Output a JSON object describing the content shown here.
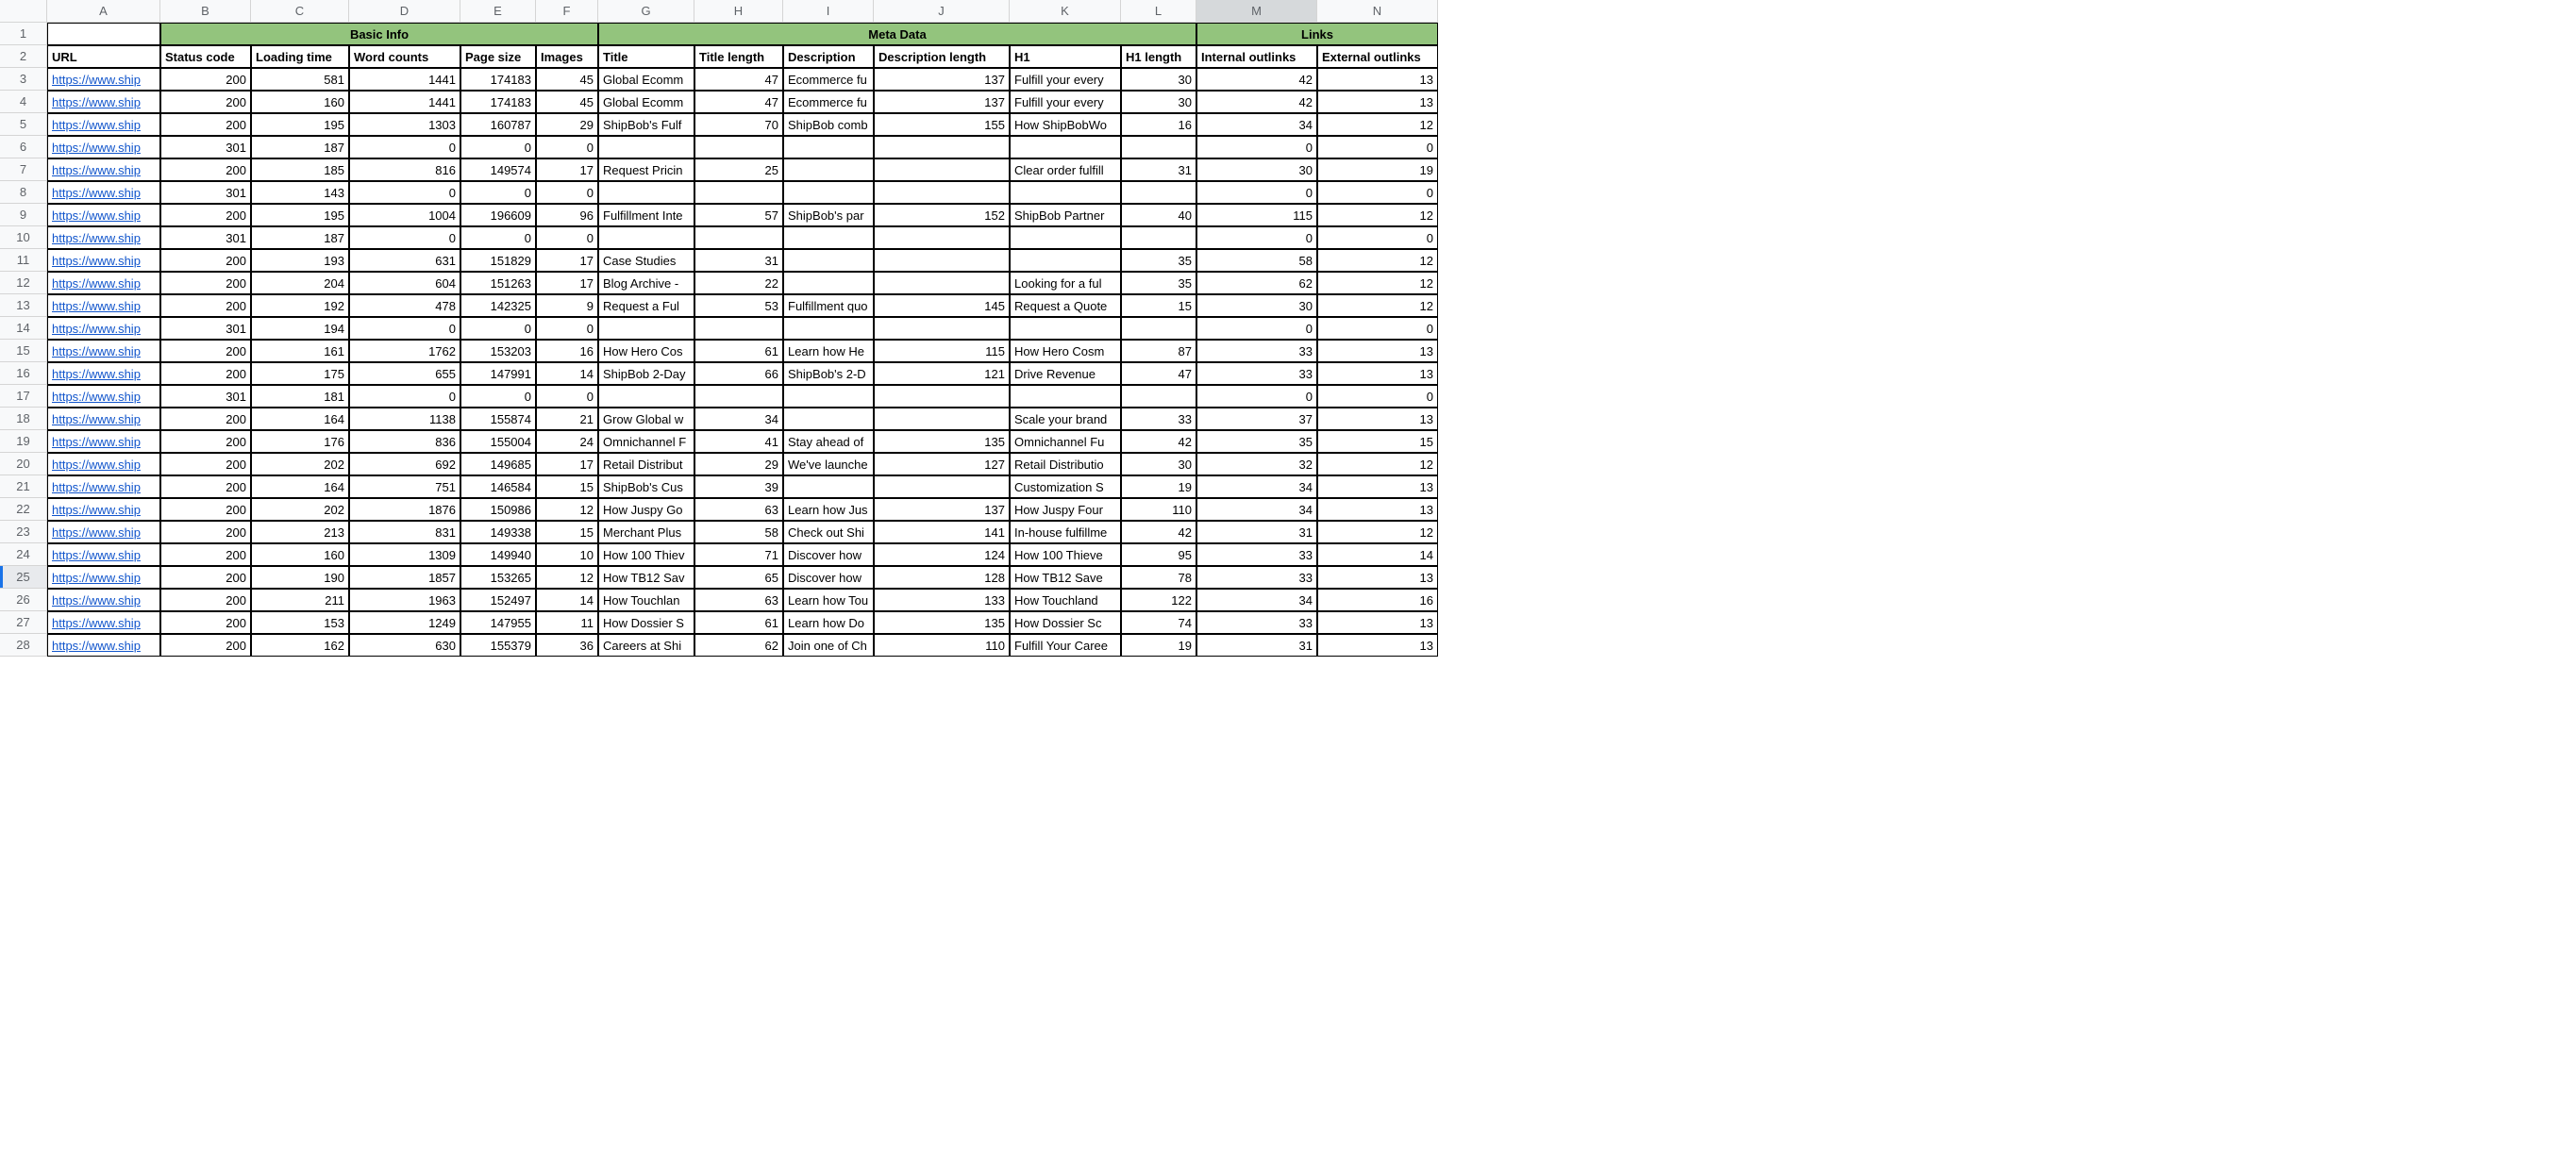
{
  "columns": [
    "A",
    "B",
    "C",
    "D",
    "E",
    "F",
    "G",
    "H",
    "I",
    "J",
    "K",
    "L",
    "M",
    "N"
  ],
  "selectedColumn": "M",
  "activeRow": 25,
  "groupHeaders": {
    "basic": "Basic Info",
    "meta": "Meta Data",
    "links": "Links"
  },
  "headers": {
    "A": "URL",
    "B": "Status code",
    "C": "Loading time",
    "D": "Word counts",
    "E": "Page size",
    "F": "Images",
    "G": "Title",
    "H": "Title length",
    "I": "Description",
    "J": "Description length",
    "K": "H1",
    "L": "H1 length",
    "M": "Internal outlinks",
    "N": "External outlinks"
  },
  "rows": [
    {
      "n": 3,
      "A": "https://www.ship",
      "B": 200,
      "C": 581,
      "D": 1441,
      "E": 174183,
      "F": 45,
      "G": "Global Ecomm",
      "H": 47,
      "I": "Ecommerce fu",
      "J": 137,
      "K": "Fulfill your every",
      "L": 30,
      "M": 42,
      "N": 13
    },
    {
      "n": 4,
      "A": "https://www.ship",
      "B": 200,
      "C": 160,
      "D": 1441,
      "E": 174183,
      "F": 45,
      "G": "Global Ecomm",
      "H": 47,
      "I": "Ecommerce fu",
      "J": 137,
      "K": "Fulfill your every",
      "L": 30,
      "M": 42,
      "N": 13
    },
    {
      "n": 5,
      "A": "https://www.ship",
      "B": 200,
      "C": 195,
      "D": 1303,
      "E": 160787,
      "F": 29,
      "G": "ShipBob's Fulf",
      "H": 70,
      "I": "ShipBob comb",
      "J": 155,
      "K": "How ShipBobWo",
      "L": 16,
      "M": 34,
      "N": 12
    },
    {
      "n": 6,
      "A": "https://www.ship",
      "B": 301,
      "C": 187,
      "D": 0,
      "E": 0,
      "F": 0,
      "G": "",
      "H": "",
      "I": "",
      "J": "",
      "K": "",
      "L": "",
      "M": 0,
      "N": 0
    },
    {
      "n": 7,
      "A": "https://www.ship",
      "B": 200,
      "C": 185,
      "D": 816,
      "E": 149574,
      "F": 17,
      "G": "Request Pricin",
      "H": 25,
      "I": "",
      "J": "",
      "K": "Clear order fulfill",
      "L": 31,
      "M": 30,
      "N": 19
    },
    {
      "n": 8,
      "A": "https://www.ship",
      "B": 301,
      "C": 143,
      "D": 0,
      "E": 0,
      "F": 0,
      "G": "",
      "H": "",
      "I": "",
      "J": "",
      "K": "",
      "L": "",
      "M": 0,
      "N": 0
    },
    {
      "n": 9,
      "A": "https://www.ship",
      "B": 200,
      "C": 195,
      "D": 1004,
      "E": 196609,
      "F": 96,
      "G": "Fulfillment Inte",
      "H": 57,
      "I": "ShipBob's par",
      "J": 152,
      "K": "ShipBob Partner",
      "L": 40,
      "M": 115,
      "N": 12
    },
    {
      "n": 10,
      "A": "https://www.ship",
      "B": 301,
      "C": 187,
      "D": 0,
      "E": 0,
      "F": 0,
      "G": "",
      "H": "",
      "I": "",
      "J": "",
      "K": "",
      "L": "",
      "M": 0,
      "N": 0
    },
    {
      "n": 11,
      "A": "https://www.ship",
      "B": 200,
      "C": 193,
      "D": 631,
      "E": 151829,
      "F": 17,
      "G": "Case Studies ",
      "H": 31,
      "I": "",
      "J": "",
      "K": "",
      "L": 35,
      "M": 58,
      "N": 12
    },
    {
      "n": 12,
      "A": "https://www.ship",
      "B": 200,
      "C": 204,
      "D": 604,
      "E": 151263,
      "F": 17,
      "G": "Blog Archive -",
      "H": 22,
      "I": "",
      "J": "",
      "K": "Looking for a ful",
      "L": 35,
      "M": 62,
      "N": 12
    },
    {
      "n": 13,
      "A": "https://www.ship",
      "B": 200,
      "C": 192,
      "D": 478,
      "E": 142325,
      "F": 9,
      "G": "Request a Ful",
      "H": 53,
      "I": "Fulfillment quo",
      "J": 145,
      "K": "Request a Quote",
      "L": 15,
      "M": 30,
      "N": 12
    },
    {
      "n": 14,
      "A": "https://www.ship",
      "B": 301,
      "C": 194,
      "D": 0,
      "E": 0,
      "F": 0,
      "G": "",
      "H": "",
      "I": "",
      "J": "",
      "K": "",
      "L": "",
      "M": 0,
      "N": 0
    },
    {
      "n": 15,
      "A": "https://www.ship",
      "B": 200,
      "C": 161,
      "D": 1762,
      "E": 153203,
      "F": 16,
      "G": "How Hero Cos",
      "H": 61,
      "I": "Learn how He",
      "J": 115,
      "K": "How Hero Cosm",
      "L": 87,
      "M": 33,
      "N": 13
    },
    {
      "n": 16,
      "A": "https://www.ship",
      "B": 200,
      "C": 175,
      "D": 655,
      "E": 147991,
      "F": 14,
      "G": "ShipBob 2-Day",
      "H": 66,
      "I": "ShipBob's 2-D",
      "J": 121,
      "K": "Drive Revenue ",
      "L": 47,
      "M": 33,
      "N": 13
    },
    {
      "n": 17,
      "A": "https://www.ship",
      "B": 301,
      "C": 181,
      "D": 0,
      "E": 0,
      "F": 0,
      "G": "",
      "H": "",
      "I": "",
      "J": "",
      "K": "",
      "L": "",
      "M": 0,
      "N": 0
    },
    {
      "n": 18,
      "A": "https://www.ship",
      "B": 200,
      "C": 164,
      "D": 1138,
      "E": 155874,
      "F": 21,
      "G": "Grow Global w",
      "H": 34,
      "I": "",
      "J": "",
      "K": "Scale your brand",
      "L": 33,
      "M": 37,
      "N": 13
    },
    {
      "n": 19,
      "A": "https://www.ship",
      "B": 200,
      "C": 176,
      "D": 836,
      "E": 155004,
      "F": 24,
      "G": "Omnichannel F",
      "H": 41,
      "I": "Stay ahead of",
      "J": 135,
      "K": "Omnichannel Fu",
      "L": 42,
      "M": 35,
      "N": 15
    },
    {
      "n": 20,
      "A": "https://www.ship",
      "B": 200,
      "C": 202,
      "D": 692,
      "E": 149685,
      "F": 17,
      "G": "Retail Distribut",
      "H": 29,
      "I": "We've launche",
      "J": 127,
      "K": "Retail Distributio",
      "L": 30,
      "M": 32,
      "N": 12
    },
    {
      "n": 21,
      "A": "https://www.ship",
      "B": 200,
      "C": 164,
      "D": 751,
      "E": 146584,
      "F": 15,
      "G": "ShipBob's Cus",
      "H": 39,
      "I": "",
      "J": "",
      "K": "Customization S",
      "L": 19,
      "M": 34,
      "N": 13
    },
    {
      "n": 22,
      "A": "https://www.ship",
      "B": 200,
      "C": 202,
      "D": 1876,
      "E": 150986,
      "F": 12,
      "G": "How Juspy Go",
      "H": 63,
      "I": "Learn how Jus",
      "J": 137,
      "K": "How Juspy Four",
      "L": 110,
      "M": 34,
      "N": 13
    },
    {
      "n": 23,
      "A": "https://www.ship",
      "B": 200,
      "C": 213,
      "D": 831,
      "E": 149338,
      "F": 15,
      "G": "Merchant Plus",
      "H": 58,
      "I": "Check out Shi",
      "J": 141,
      "K": "In-house fulfillme",
      "L": 42,
      "M": 31,
      "N": 12
    },
    {
      "n": 24,
      "A": "https://www.ship",
      "B": 200,
      "C": 160,
      "D": 1309,
      "E": 149940,
      "F": 10,
      "G": "How 100 Thiev",
      "H": 71,
      "I": "Discover how ",
      "J": 124,
      "K": "How 100 Thieve",
      "L": 95,
      "M": 33,
      "N": 14
    },
    {
      "n": 25,
      "A": "https://www.ship",
      "B": 200,
      "C": 190,
      "D": 1857,
      "E": 153265,
      "F": 12,
      "G": "How TB12 Sav",
      "H": 65,
      "I": "Discover how ",
      "J": 128,
      "K": "How TB12 Save",
      "L": 78,
      "M": 33,
      "N": 13
    },
    {
      "n": 26,
      "A": "https://www.ship",
      "B": 200,
      "C": 211,
      "D": 1963,
      "E": 152497,
      "F": 14,
      "G": "How Touchlan",
      "H": 63,
      "I": "Learn how Tou",
      "J": 133,
      "K": "How Touchland ",
      "L": 122,
      "M": 34,
      "N": 16
    },
    {
      "n": 27,
      "A": "https://www.ship",
      "B": 200,
      "C": 153,
      "D": 1249,
      "E": 147955,
      "F": 11,
      "G": "How Dossier S",
      "H": 61,
      "I": "Learn how Do",
      "J": 135,
      "K": "How Dossier Sc",
      "L": 74,
      "M": 33,
      "N": 13
    },
    {
      "n": 28,
      "A": "https://www.ship",
      "B": 200,
      "C": 162,
      "D": 630,
      "E": 155379,
      "F": 36,
      "G": "Careers at Shi",
      "H": 62,
      "I": "Join one of Ch",
      "J": 110,
      "K": "Fulfill Your Caree",
      "L": 19,
      "M": 31,
      "N": 13
    }
  ]
}
